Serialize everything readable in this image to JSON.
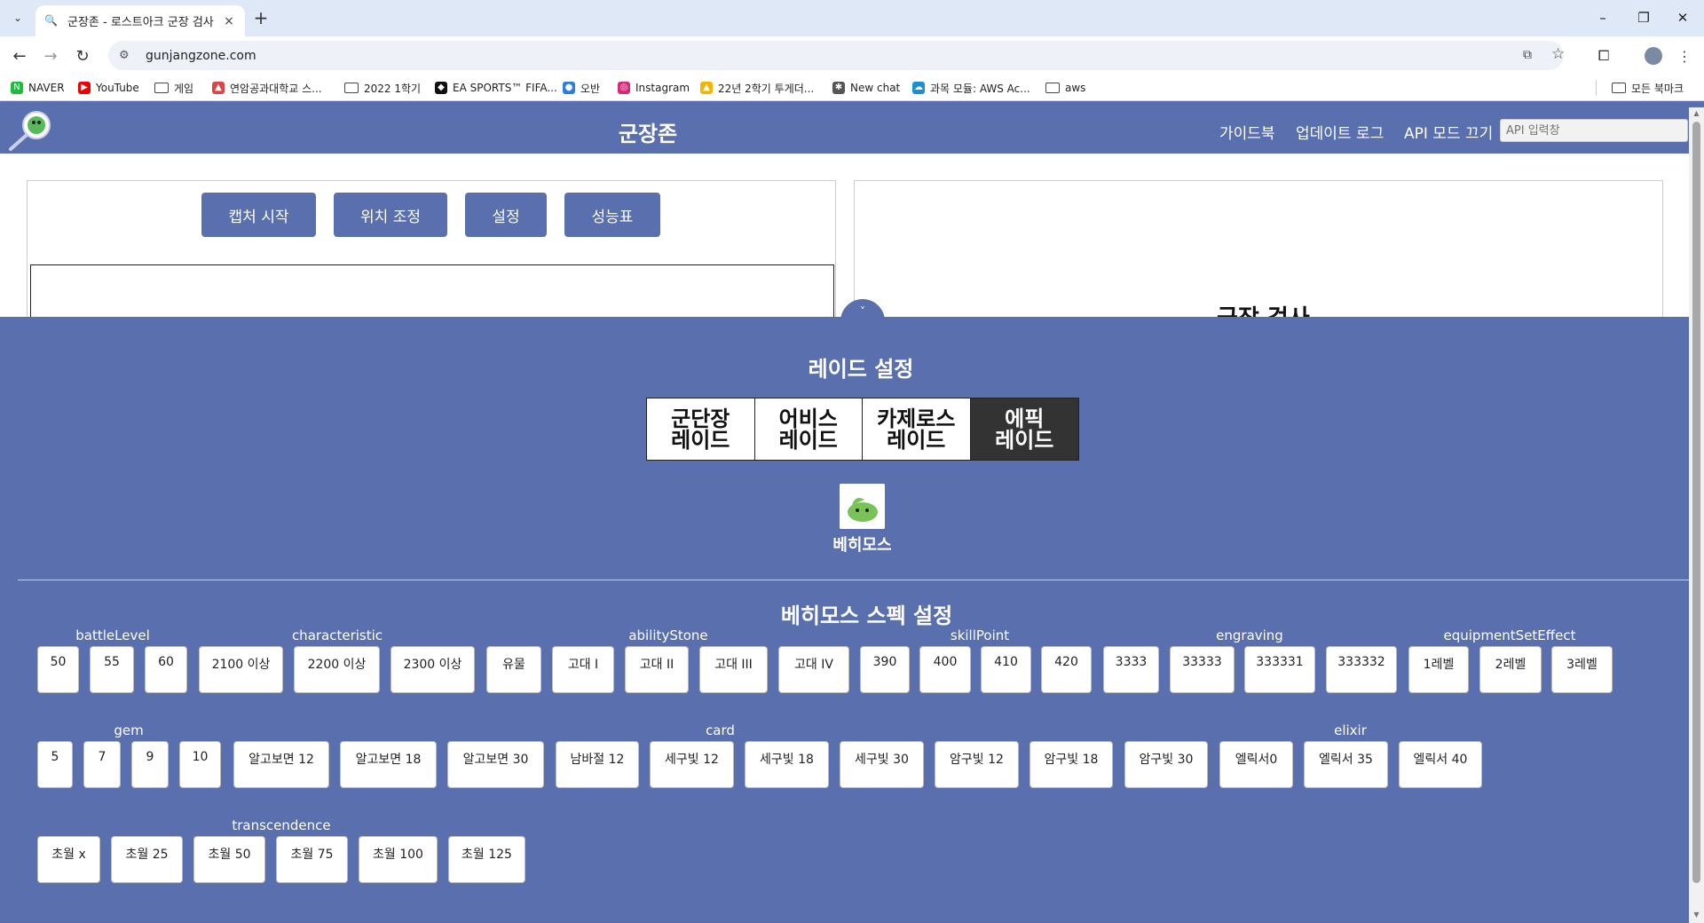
{
  "browser": {
    "tab_title": "군장존 - 로스트아크 군장 검사",
    "url": "gunjangzone.com",
    "bookmarks": [
      "NAVER",
      "YouTube",
      "게임",
      "연암공과대학교 스...",
      "2022 1학기",
      "EA SPORTS™ FIFA...",
      "오반",
      "Instagram",
      "22년 2학기 투게더...",
      "New chat",
      "과목 모듈: AWS Ac...",
      "aws"
    ],
    "all_bookmarks": "모든 북마크"
  },
  "header": {
    "site_title": "군장존",
    "nav": [
      "가이드북",
      "업데이트 로그",
      "API 모드 끄기"
    ],
    "api_placeholder": "API 입력창"
  },
  "main": {
    "buttons": [
      "캡처 시작",
      "위치 조정",
      "설정",
      "성능표"
    ],
    "right_caption": "군장 검사"
  },
  "settings": {
    "toggle": "˅",
    "raid_title": "레이드 설정",
    "raid_tabs": [
      "군단장\n레이드",
      "어비스\n레이드",
      "카제로스\n레이드",
      "에픽\n레이드"
    ],
    "active_raid_index": 3,
    "boss_name": "베히모스",
    "spec_title": "베히모스 스펙 설정",
    "groups": {
      "battleLevel": {
        "label": "battleLevel",
        "options": [
          "50",
          "55",
          "60"
        ]
      },
      "characteristic": {
        "label": "characteristic",
        "options": [
          "2100 이상",
          "2200 이상",
          "2300 이상"
        ]
      },
      "abilityStone": {
        "label": "abilityStone",
        "options": [
          "유물",
          "고대 I",
          "고대 II",
          "고대 III",
          "고대 IV"
        ]
      },
      "skillPoint": {
        "label": "skillPoint",
        "options": [
          "390",
          "400",
          "410",
          "420"
        ]
      },
      "engraving": {
        "label": "engraving",
        "options": [
          "3333",
          "33333",
          "333331",
          "333332"
        ]
      },
      "equipmentSetEffect": {
        "label": "equipmentSetEffect",
        "options": [
          "1레벨",
          "2레벨",
          "3레벨"
        ]
      },
      "gem": {
        "label": "gem",
        "options": [
          "5",
          "7",
          "9",
          "10"
        ]
      },
      "card": {
        "label": "card",
        "options": [
          "알고보면 12",
          "알고보면 18",
          "알고보면 30",
          "남바절 12",
          "세구빛 12",
          "세구빛 18",
          "세구빛 30",
          "암구빛 12",
          "암구빛 18",
          "암구빛 30"
        ]
      },
      "elixir": {
        "label": "elixir",
        "options": [
          "엘릭서0",
          "엘릭서 35",
          "엘릭서 40"
        ]
      },
      "transcendence": {
        "label": "transcendence",
        "options": [
          "초월 x",
          "초월 25",
          "초월 50",
          "초월 75",
          "초월 100",
          "초월 125"
        ]
      }
    }
  }
}
